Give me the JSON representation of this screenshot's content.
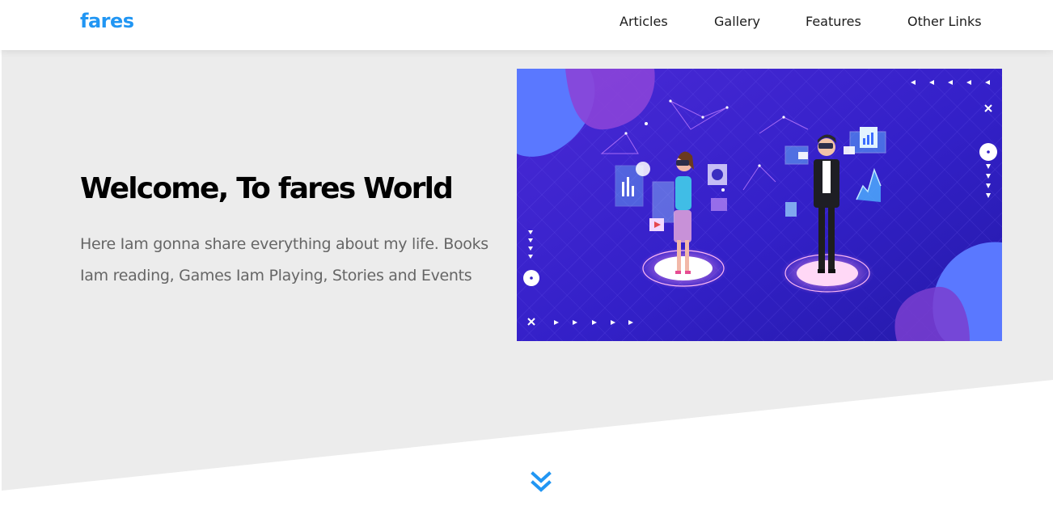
{
  "header": {
    "logo": "fares",
    "nav": [
      {
        "label": "Articles"
      },
      {
        "label": "Gallery"
      },
      {
        "label": "Features"
      },
      {
        "label": "Other Links"
      }
    ]
  },
  "hero": {
    "title": "Welcome, To fares World",
    "text": "Here Iam gonna share everything about my life. Books Iam reading, Games Iam Playing, Stories and Events",
    "image_icon": "vr-illustration"
  },
  "scroll_icon": "double-chevron-down-icon",
  "colors": {
    "brand": "#2196f3",
    "hero_bg": "#ececec",
    "text_dark": "#000000",
    "text_muted": "#666666"
  }
}
